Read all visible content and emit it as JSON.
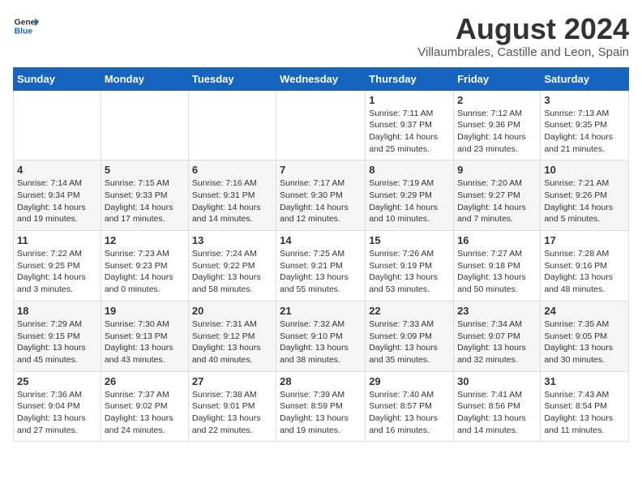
{
  "header": {
    "logo_line1": "General",
    "logo_line2": "Blue",
    "main_title": "August 2024",
    "subtitle": "Villaumbrales, Castille and Leon, Spain"
  },
  "calendar": {
    "weekdays": [
      "Sunday",
      "Monday",
      "Tuesday",
      "Wednesday",
      "Thursday",
      "Friday",
      "Saturday"
    ],
    "weeks": [
      [
        {
          "date": "",
          "info": ""
        },
        {
          "date": "",
          "info": ""
        },
        {
          "date": "",
          "info": ""
        },
        {
          "date": "",
          "info": ""
        },
        {
          "date": "1",
          "info": "Sunrise: 7:11 AM\nSunset: 9:37 PM\nDaylight: 14 hours and 25 minutes."
        },
        {
          "date": "2",
          "info": "Sunrise: 7:12 AM\nSunset: 9:36 PM\nDaylight: 14 hours and 23 minutes."
        },
        {
          "date": "3",
          "info": "Sunrise: 7:13 AM\nSunset: 9:35 PM\nDaylight: 14 hours and 21 minutes."
        }
      ],
      [
        {
          "date": "4",
          "info": "Sunrise: 7:14 AM\nSunset: 9:34 PM\nDaylight: 14 hours and 19 minutes."
        },
        {
          "date": "5",
          "info": "Sunrise: 7:15 AM\nSunset: 9:33 PM\nDaylight: 14 hours and 17 minutes."
        },
        {
          "date": "6",
          "info": "Sunrise: 7:16 AM\nSunset: 9:31 PM\nDaylight: 14 hours and 14 minutes."
        },
        {
          "date": "7",
          "info": "Sunrise: 7:17 AM\nSunset: 9:30 PM\nDaylight: 14 hours and 12 minutes."
        },
        {
          "date": "8",
          "info": "Sunrise: 7:19 AM\nSunset: 9:29 PM\nDaylight: 14 hours and 10 minutes."
        },
        {
          "date": "9",
          "info": "Sunrise: 7:20 AM\nSunset: 9:27 PM\nDaylight: 14 hours and 7 minutes."
        },
        {
          "date": "10",
          "info": "Sunrise: 7:21 AM\nSunset: 9:26 PM\nDaylight: 14 hours and 5 minutes."
        }
      ],
      [
        {
          "date": "11",
          "info": "Sunrise: 7:22 AM\nSunset: 9:25 PM\nDaylight: 14 hours and 3 minutes."
        },
        {
          "date": "12",
          "info": "Sunrise: 7:23 AM\nSunset: 9:23 PM\nDaylight: 14 hours and 0 minutes."
        },
        {
          "date": "13",
          "info": "Sunrise: 7:24 AM\nSunset: 9:22 PM\nDaylight: 13 hours and 58 minutes."
        },
        {
          "date": "14",
          "info": "Sunrise: 7:25 AM\nSunset: 9:21 PM\nDaylight: 13 hours and 55 minutes."
        },
        {
          "date": "15",
          "info": "Sunrise: 7:26 AM\nSunset: 9:19 PM\nDaylight: 13 hours and 53 minutes."
        },
        {
          "date": "16",
          "info": "Sunrise: 7:27 AM\nSunset: 9:18 PM\nDaylight: 13 hours and 50 minutes."
        },
        {
          "date": "17",
          "info": "Sunrise: 7:28 AM\nSunset: 9:16 PM\nDaylight: 13 hours and 48 minutes."
        }
      ],
      [
        {
          "date": "18",
          "info": "Sunrise: 7:29 AM\nSunset: 9:15 PM\nDaylight: 13 hours and 45 minutes."
        },
        {
          "date": "19",
          "info": "Sunrise: 7:30 AM\nSunset: 9:13 PM\nDaylight: 13 hours and 43 minutes."
        },
        {
          "date": "20",
          "info": "Sunrise: 7:31 AM\nSunset: 9:12 PM\nDaylight: 13 hours and 40 minutes."
        },
        {
          "date": "21",
          "info": "Sunrise: 7:32 AM\nSunset: 9:10 PM\nDaylight: 13 hours and 38 minutes."
        },
        {
          "date": "22",
          "info": "Sunrise: 7:33 AM\nSunset: 9:09 PM\nDaylight: 13 hours and 35 minutes."
        },
        {
          "date": "23",
          "info": "Sunrise: 7:34 AM\nSunset: 9:07 PM\nDaylight: 13 hours and 32 minutes."
        },
        {
          "date": "24",
          "info": "Sunrise: 7:35 AM\nSunset: 9:05 PM\nDaylight: 13 hours and 30 minutes."
        }
      ],
      [
        {
          "date": "25",
          "info": "Sunrise: 7:36 AM\nSunset: 9:04 PM\nDaylight: 13 hours and 27 minutes."
        },
        {
          "date": "26",
          "info": "Sunrise: 7:37 AM\nSunset: 9:02 PM\nDaylight: 13 hours and 24 minutes."
        },
        {
          "date": "27",
          "info": "Sunrise: 7:38 AM\nSunset: 9:01 PM\nDaylight: 13 hours and 22 minutes."
        },
        {
          "date": "28",
          "info": "Sunrise: 7:39 AM\nSunset: 8:59 PM\nDaylight: 13 hours and 19 minutes."
        },
        {
          "date": "29",
          "info": "Sunrise: 7:40 AM\nSunset: 8:57 PM\nDaylight: 13 hours and 16 minutes."
        },
        {
          "date": "30",
          "info": "Sunrise: 7:41 AM\nSunset: 8:56 PM\nDaylight: 13 hours and 14 minutes."
        },
        {
          "date": "31",
          "info": "Sunrise: 7:43 AM\nSunset: 8:54 PM\nDaylight: 13 hours and 11 minutes."
        }
      ]
    ]
  }
}
